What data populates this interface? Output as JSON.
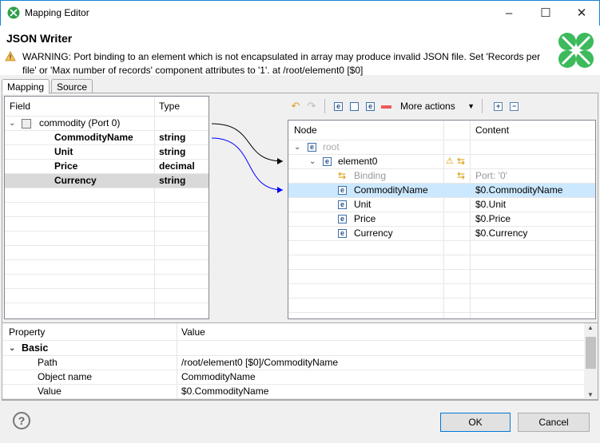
{
  "window": {
    "title": "Mapping Editor",
    "minimize": "–",
    "maximize": "☐",
    "close": "✕"
  },
  "header": {
    "title": "JSON Writer",
    "warning": "WARNING: Port binding to an element which is not encapsulated in array may produce invalid JSON file. Set 'Records per file' or 'Max number of records' component attributes to '1'. at /root/element0 [$0]"
  },
  "tabs": [
    {
      "label": "Mapping",
      "active": true
    },
    {
      "label": "Source",
      "active": false
    }
  ],
  "source_tree": {
    "columns": [
      "Field",
      "Type"
    ],
    "root": {
      "label": "commodity (Port 0)"
    },
    "fields": [
      {
        "name": "CommodityName",
        "type": "string"
      },
      {
        "name": "Unit",
        "type": "string"
      },
      {
        "name": "Price",
        "type": "decimal"
      },
      {
        "name": "Currency",
        "type": "string",
        "selected": true
      }
    ]
  },
  "toolbar": {
    "more_actions": "More actions"
  },
  "target_tree": {
    "columns": [
      "Node",
      "",
      "Content"
    ],
    "rows": [
      {
        "label": "root",
        "content": "",
        "level": 0
      },
      {
        "label": "element0",
        "content": "",
        "level": 1
      },
      {
        "label": "Binding",
        "content": "Port: '0'",
        "level": 2
      },
      {
        "label": "CommodityName",
        "content": "$0.CommodityName",
        "level": 2,
        "selected": true
      },
      {
        "label": "Unit",
        "content": "$0.Unit",
        "level": 2
      },
      {
        "label": "Price",
        "content": "$0.Price",
        "level": 2
      },
      {
        "label": "Currency",
        "content": "$0.Currency",
        "level": 2
      }
    ]
  },
  "properties": {
    "columns": [
      "Property",
      "Value"
    ],
    "group": "Basic",
    "rows": [
      {
        "name": "Path",
        "value": "/root/element0 [$0]/CommodityName"
      },
      {
        "name": "Object name",
        "value": "CommodityName"
      },
      {
        "name": "Value",
        "value": "$0.CommodityName"
      }
    ]
  },
  "footer": {
    "ok": "OK",
    "cancel": "Cancel",
    "help": "?"
  },
  "colors": {
    "accent": "#1883d7",
    "selection": "#cce8ff",
    "logo": "#3cba5c",
    "mapping_line_1": "#000000",
    "mapping_line_2": "#0000ff"
  }
}
